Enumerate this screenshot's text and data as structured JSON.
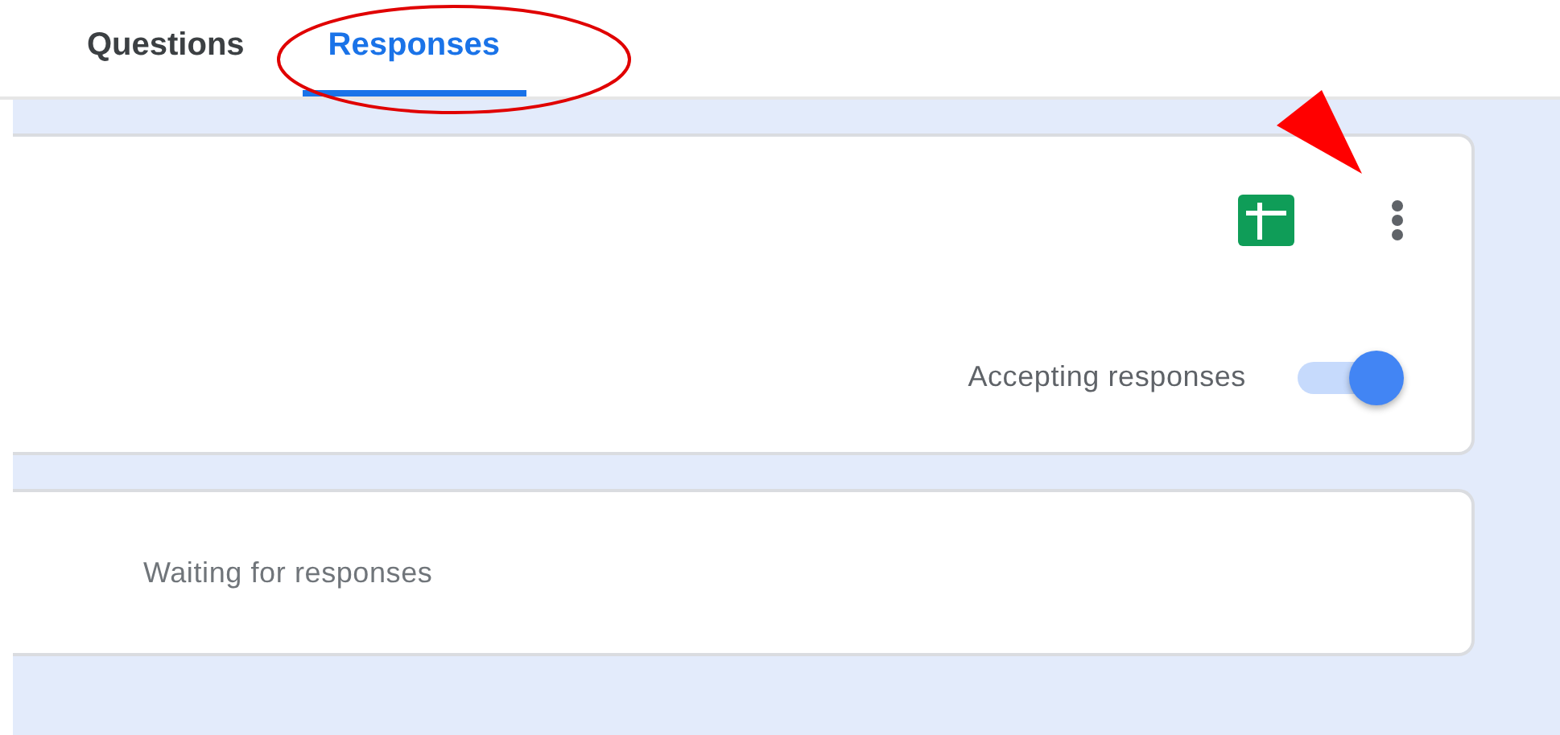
{
  "tabs": [
    {
      "label": "Questions",
      "selected": false
    },
    {
      "label": "Responses",
      "selected": true
    }
  ],
  "responses_card": {
    "accepting_label": "Accepting responses",
    "accepting_on": true
  },
  "summary_card": {
    "status": "Waiting for responses"
  }
}
